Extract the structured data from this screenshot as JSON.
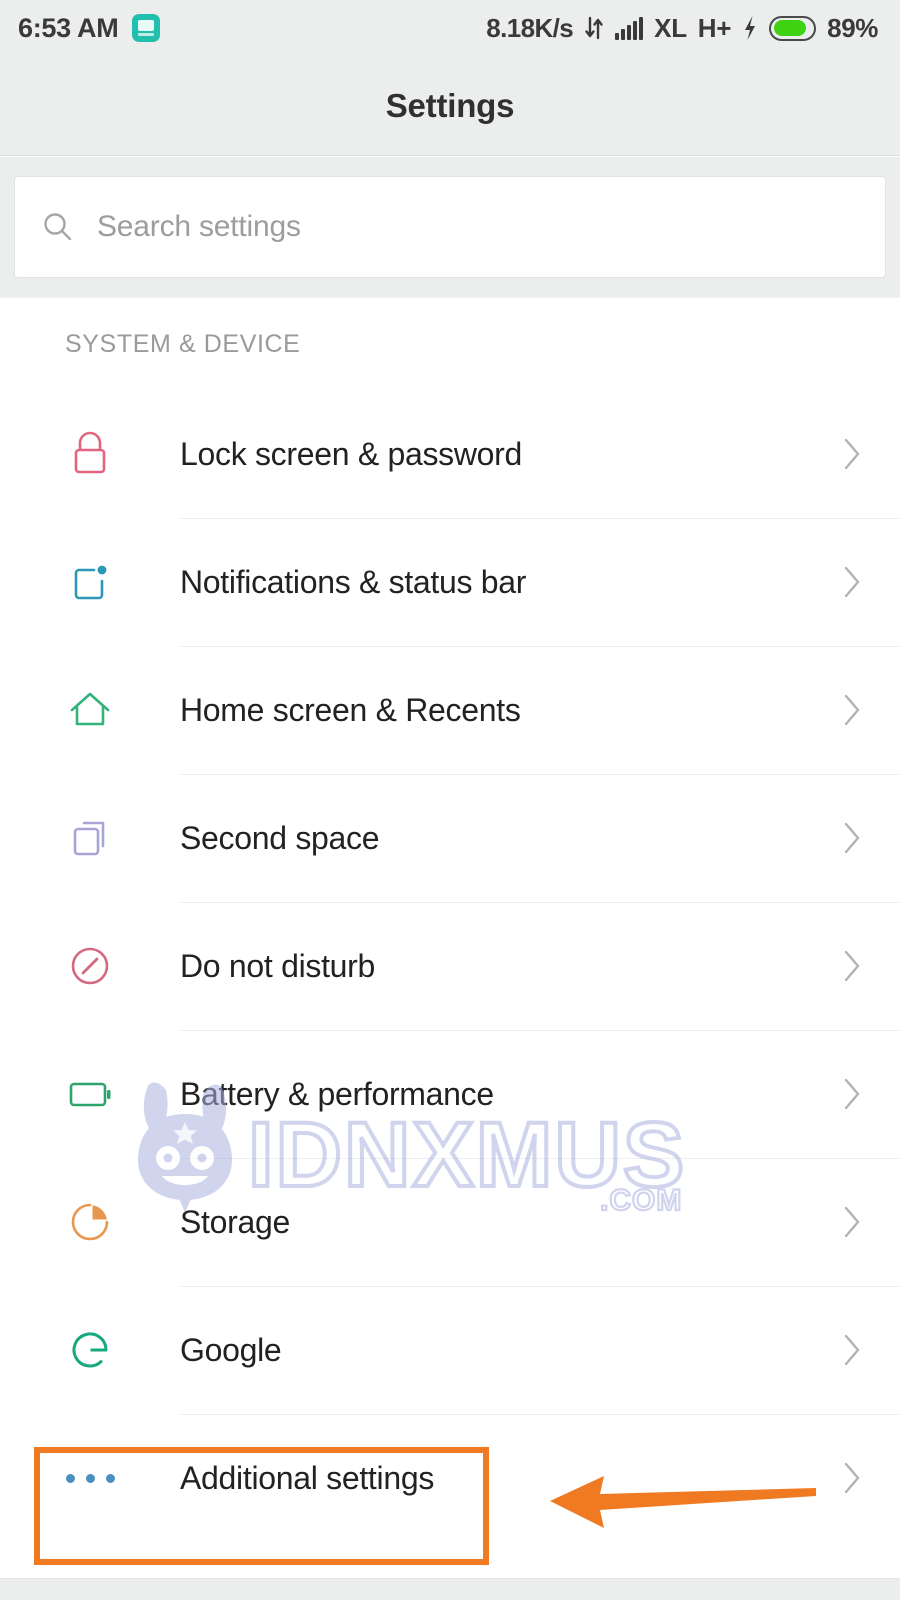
{
  "status_bar": {
    "time": "6:53 AM",
    "app_icon": "messaging-app-icon",
    "network_speed": "8.18K/s",
    "data_transfer_icon": "data-transfer-icon",
    "signal_icon": "signal-bars-icon",
    "carrier": "XL",
    "network_type": "H+",
    "charging_icon": "lightning-bolt-icon",
    "battery_icon": "battery-icon",
    "battery_percent": "89%"
  },
  "header": {
    "title": "Settings"
  },
  "search": {
    "icon": "search-icon",
    "placeholder": "Search settings",
    "value": ""
  },
  "section": {
    "label": "SYSTEM & DEVICE"
  },
  "rows": [
    {
      "label": "Lock screen & password",
      "icon": "lock-icon",
      "icon_color": "#e2657f",
      "chevron": "chevron-right-icon"
    },
    {
      "label": "Notifications & status bar",
      "icon": "notification-icon",
      "icon_color": "#2b97b8",
      "chevron": "chevron-right-icon"
    },
    {
      "label": "Home screen & Recents",
      "icon": "home-icon",
      "icon_color": "#34b27b",
      "chevron": "chevron-right-icon"
    },
    {
      "label": "Second space",
      "icon": "second-space-icon",
      "icon_color": "#a7a4d6",
      "chevron": "chevron-right-icon"
    },
    {
      "label": "Do not disturb",
      "icon": "do-not-disturb-icon",
      "icon_color": "#d4697f",
      "chevron": "chevron-right-icon"
    },
    {
      "label": "Battery & performance",
      "icon": "battery-outline-icon",
      "icon_color": "#2fa36b",
      "chevron": "chevron-right-icon"
    },
    {
      "label": "Storage",
      "icon": "pie-chart-icon",
      "icon_color": "#e8974e",
      "chevron": "chevron-right-icon"
    },
    {
      "label": "Google",
      "icon": "google-g-icon",
      "icon_color": "#17a97f",
      "chevron": "chevron-right-icon"
    },
    {
      "label": "Additional settings",
      "icon": "more-dots-icon",
      "icon_color": "#4a8fc0",
      "chevron": "chevron-right-icon"
    }
  ],
  "watermark": {
    "text": "IDNXMUS",
    "suffix": ".COM",
    "mascot": "mi-bunny-mascot-icon",
    "color": "#aab1e0"
  },
  "annotations": {
    "highlight_box": "additional-settings-highlight",
    "arrow": "pointer-arrow-left",
    "color": "#f07a21"
  }
}
